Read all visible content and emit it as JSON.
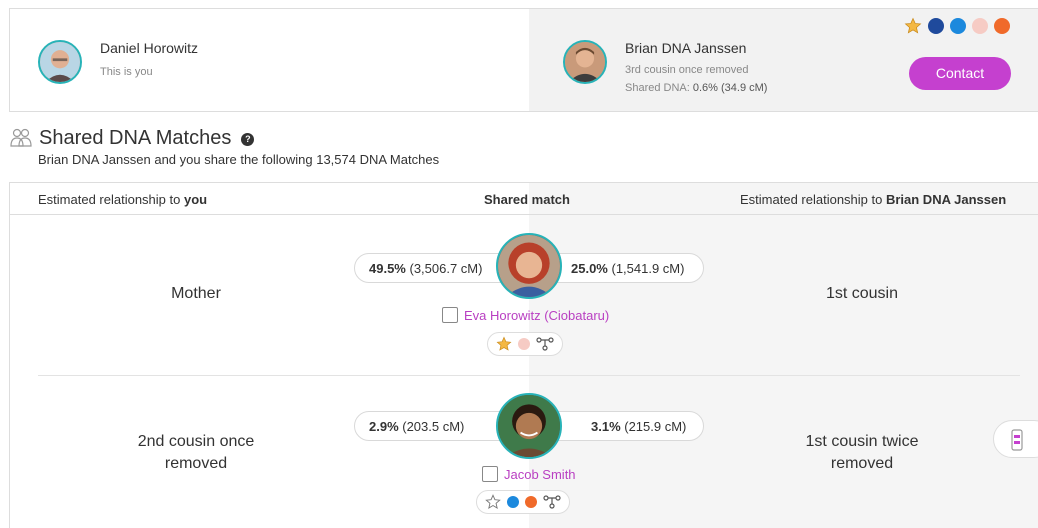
{
  "user": {
    "name": "Daniel Horowitz",
    "subtitle": "This is you"
  },
  "match_person": {
    "name": "Brian DNA Janssen",
    "relationship": "3rd cousin once removed",
    "shared_dna_label": "Shared DNA:",
    "shared_dna_value": "0.6% (34.9 cM)"
  },
  "contact_label": "Contact",
  "filter_dots": {
    "colors": [
      "#f4b843",
      "#1f4a9c",
      "#1c89dd",
      "#f6cbc4",
      "#f06a2a"
    ]
  },
  "section": {
    "title": "Shared DNA Matches",
    "description": "Brian DNA Janssen and you share the following 13,574 DNA Matches"
  },
  "table": {
    "col_left_prefix": "Estimated relationship to ",
    "col_left_bold": "you",
    "col_center": "Shared match",
    "col_right_prefix": "Estimated relationship to ",
    "col_right_bold": "Brian DNA Janssen",
    "rows": [
      {
        "rel_you": "Mother",
        "left_pct": "49.5%",
        "left_cm": " (3,506.7 cM)",
        "right_pct": "25.0%",
        "right_cm": " (1,541.9 cM)",
        "name": "Eva Horowitz (Ciobataru)",
        "rel_other": "1st cousin",
        "tag_colors": [
          "#f6cbc4"
        ]
      },
      {
        "rel_you_1": "2nd cousin once",
        "rel_you_2": "removed",
        "left_pct": "2.9%",
        "left_cm": " (203.5 cM)",
        "right_pct": "3.1%",
        "right_cm": " (215.9 cM)",
        "name": "Jacob Smith",
        "rel_other_1": "1st cousin twice",
        "rel_other_2": "removed",
        "tag_colors": [
          "#1c89dd",
          "#f06a2a"
        ]
      }
    ]
  }
}
